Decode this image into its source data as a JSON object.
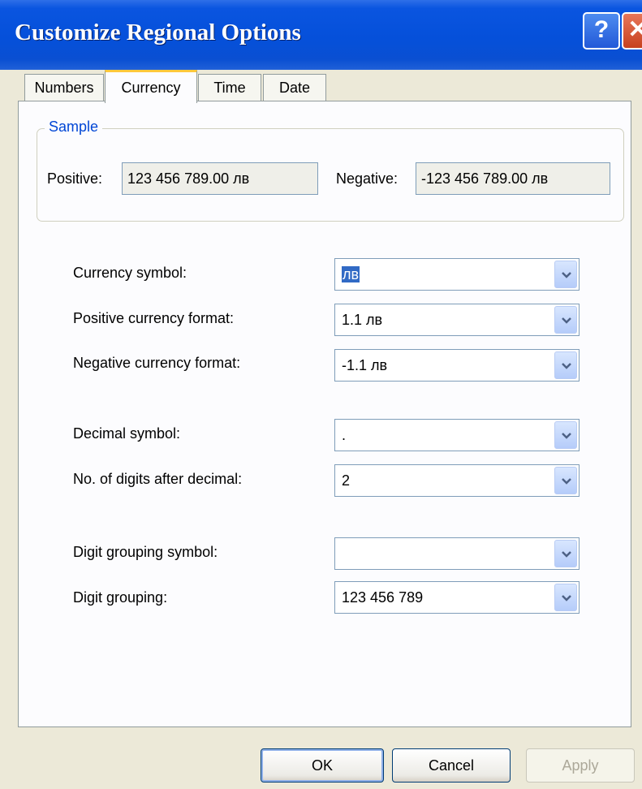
{
  "window": {
    "title": "Customize Regional Options",
    "help_glyph": "?",
    "close_glyph": "✕"
  },
  "tabs": [
    "Numbers",
    "Currency",
    "Time",
    "Date"
  ],
  "active_tab": "Currency",
  "sample": {
    "legend": "Sample",
    "positive_label": "Positive:",
    "positive_value": "123 456 789.00 лв",
    "negative_label": "Negative:",
    "negative_value": "-123 456 789.00 лв"
  },
  "fields": [
    {
      "label": "Currency symbol:",
      "value": "лв",
      "selected": true
    },
    {
      "label": "Positive currency format:",
      "value": "1.1 лв"
    },
    {
      "label": "Negative currency format:",
      "value": "-1.1 лв"
    },
    {
      "label": "Decimal symbol:",
      "value": "."
    },
    {
      "label": "No. of digits after decimal:",
      "value": "2"
    },
    {
      "label": "Digit grouping symbol:",
      "value": ""
    },
    {
      "label": "Digit grouping:",
      "value": "123 456 789"
    }
  ],
  "buttons": {
    "ok": "OK",
    "cancel": "Cancel",
    "apply": "Apply"
  },
  "colors": {
    "titlebar": "#0A55E0",
    "dialog_bg": "#ECE9D8",
    "legend_text": "#0046D5",
    "active_tab_accent": "#FFC83C"
  }
}
